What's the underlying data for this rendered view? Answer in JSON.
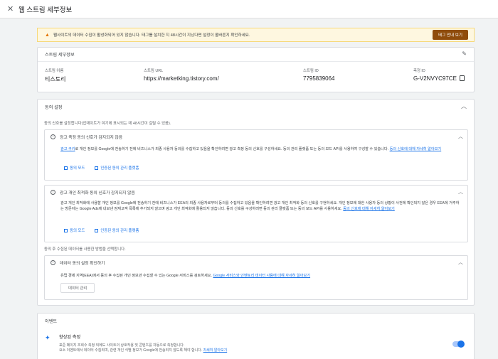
{
  "header": {
    "close_label": "✕",
    "title": "웹 스트림 세부정보"
  },
  "banner": {
    "text": "웹사이트의 데이터 수집이 활성화되어 있지 않습니다. 태그를 설치한 지 48시간이 지났다면 설정이 올바른지 확인하세요.",
    "button": "태그 안내 보기"
  },
  "stream": {
    "heading": "스트림 세부정보",
    "name_label": "스트림 이름",
    "name": "티스토리",
    "url_label": "스트림 URL",
    "url": "https://marketking.tistory.com/",
    "id_label": "스트림 ID",
    "id": "7795839064",
    "mid_label": "측정 ID",
    "mid": "G-V2NVYC97CE"
  },
  "consent": {
    "heading": "동의 설정",
    "intro": "동의 신호를 설정합니다(업데이트가 여기에 표시되는 데 48시간이 걸릴 수 있음).",
    "ads": {
      "title": "광고 측정 동의 신호가 감지되지 않음",
      "body_link": "광고 쿠키",
      "body": "로 개인 정보를 Google에 전송하기 전에 비즈니스가 최종 사용자 동의를 수집하고 있음을 확인하려면 광고 측정 동의 신호를 구성하세요. 동의 관리 플랫폼 또는 동의 모드 API를 사용하여 구성할 수 있습니다.",
      "more_link": "동의 신호에 대해 자세히 알아보기",
      "link1": "동의 모드",
      "link2": "인증된 동의 관리 플랫폼"
    },
    "personal": {
      "title": "광고 개인 최적화 동의 신호가 감지되지 않음",
      "body": "광고 개인 최적화에 사용할 개인 정보를 Google에 전송하기 전에 비즈니스가 EEA의 최종 사용자로부터 동의를 수집하고 있음을 확인하려면 광고 개인 최적화 동의 신호를 구현하세요. 개인 정보에 대한 사용자 동의 상황이 사전에 확인되지 않은 경우 EEA에 거주하는 방문자는 Google Ads에 내보낸 잠재고객 목록에 추가되지 않으며 광고 개인 최적화에 활용되지 않습니다. 동의 신호를 구성하려면 동의 관리 플랫폼 또는 동의 모드 API를 사용하세요.",
      "more_link": "동의 신호에 대해 자세히 알아보기",
      "link1": "동의 모드",
      "link2": "인증된 동의 관리 플랫폼"
    },
    "usage_intro": "동의 후 수집된 데이터를 사용한 방법을 선택합니다.",
    "data": {
      "title": "데이터 동의 설정 확인하기",
      "body": "유럽 경제 지역(EEA)에서 동의 후 수집된 개인 정보만 수집할 수 있는 Google 서비스를 검토하세요.",
      "link": "Google 서비스와 인벤토리 데이터 사용에 대해 자세히 알아보기",
      "button": "데이터 관리"
    }
  },
  "events": {
    "heading": "이벤트",
    "enhanced_title": "향상된 측정",
    "enhanced_desc1": "표준 페이지 조회수 측정 외에도 사이트의 상호작용 및 콘텐츠를 자동으로 측정합니다.",
    "enhanced_desc2": "요소 이벤트에서 데이터 수집되며, 관련 개인 식별 정보가 Google에 전송되지 않도록 해야 합니다.",
    "enhanced_link": "자세히 알아보기",
    "toggle_on": true
  },
  "colors": {
    "accent": "#1a73e8",
    "warning": "#e37400",
    "banner_button": "#8f4c0b"
  }
}
